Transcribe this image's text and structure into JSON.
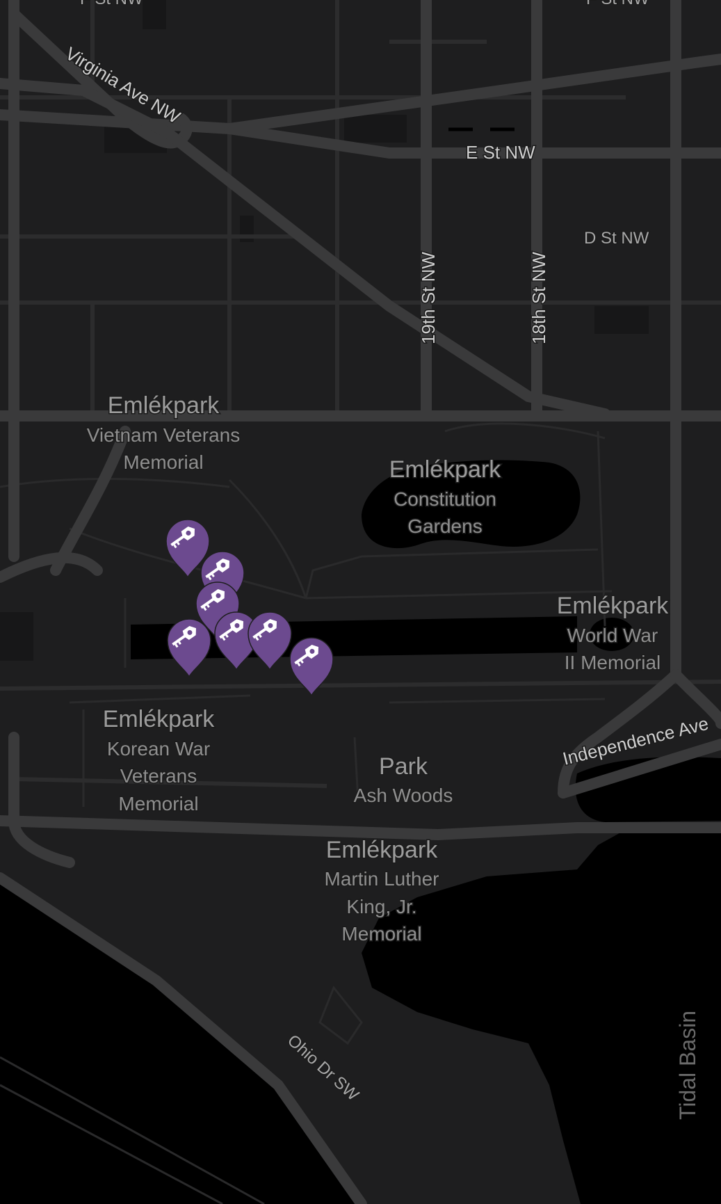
{
  "map": {
    "theme": "dark",
    "colors": {
      "land": "#1e1e1f",
      "water": "#000000",
      "road_major": "#3a3a3b",
      "road_minor": "#2c2c2d",
      "path": "#2a2a2b",
      "pin": "#6c4a8f"
    },
    "streets": {
      "virginia_ave": "Virginia Ave NW",
      "e_st": "E St NW",
      "d_st": "D St NW",
      "st19": "19th St NW",
      "st18": "18th St NW",
      "independence": "Independence Ave",
      "ohio_dr": "Ohio Dr SW",
      "top_left": "F St NW",
      "top_right": "F St NW"
    },
    "water_labels": {
      "tidal_basin": "Tidal Basin"
    },
    "places": [
      {
        "key": "vietnam",
        "type": "Emlékpark",
        "name": [
          "Vietnam Veterans",
          "Memorial"
        ]
      },
      {
        "key": "constitution",
        "type": "Emlékpark",
        "name": [
          "Constitution",
          "Gardens"
        ]
      },
      {
        "key": "wwii",
        "type": "Emlékpark",
        "name": [
          "World War",
          "II Memorial"
        ]
      },
      {
        "key": "korean",
        "type": "Emlékpark",
        "name": [
          "Korean War",
          "Veterans",
          "Memorial"
        ]
      },
      {
        "key": "ashwoods",
        "type": "Park",
        "name": [
          "Ash Woods"
        ]
      },
      {
        "key": "mlk",
        "type": "Emlékpark",
        "name": [
          "Martin Luther",
          "King, Jr.",
          "Memorial"
        ]
      }
    ],
    "markers": [
      {
        "icon": "key-icon"
      },
      {
        "icon": "key-icon"
      },
      {
        "icon": "key-icon"
      },
      {
        "icon": "key-icon"
      },
      {
        "icon": "key-icon"
      },
      {
        "icon": "key-icon"
      },
      {
        "icon": "key-icon"
      }
    ]
  }
}
